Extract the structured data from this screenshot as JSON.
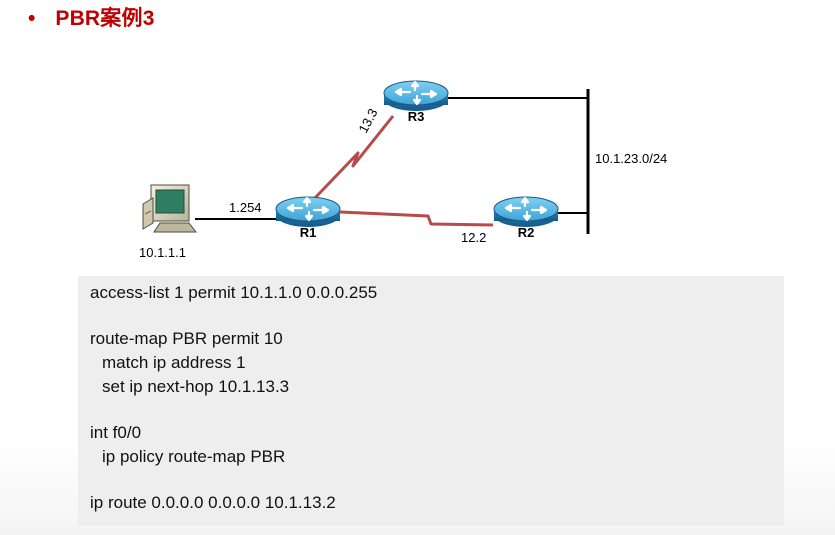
{
  "header": {
    "bullet": "•",
    "title": "PBR案例3"
  },
  "diagram": {
    "routers": [
      {
        "id": "r1",
        "label": "R1"
      },
      {
        "id": "r2",
        "label": "R2"
      },
      {
        "id": "r3",
        "label": "R3"
      }
    ],
    "host": {
      "label": "10.1.1.1"
    },
    "labels": {
      "r1_lan": "1.254",
      "r1_r3": "13.3",
      "r1_r2": "12.2",
      "lan": "10.1.23.0/24"
    },
    "colors": {
      "serial_link": "#b84a4a",
      "router_body": "#2f8fc5",
      "router_top": "#58b7e6",
      "router_dark": "#1a5a88",
      "lan_line": "#000000",
      "title": "#c00000"
    }
  },
  "config": {
    "lines": [
      {
        "text": "access-list 1 permit 10.1.1.0 0.0.0.255",
        "indent": false
      },
      {
        "text": "route-map PBR permit 10",
        "indent": false
      },
      {
        "text": "match ip address 1",
        "indent": true
      },
      {
        "text": "set ip next-hop 10.1.13.3",
        "indent": true
      },
      {
        "text": "int f0/0",
        "indent": false
      },
      {
        "text": "ip policy route-map PBR",
        "indent": true
      },
      {
        "text": "ip route 0.0.0.0 0.0.0.0 10.1.13.2",
        "indent": false
      }
    ]
  }
}
